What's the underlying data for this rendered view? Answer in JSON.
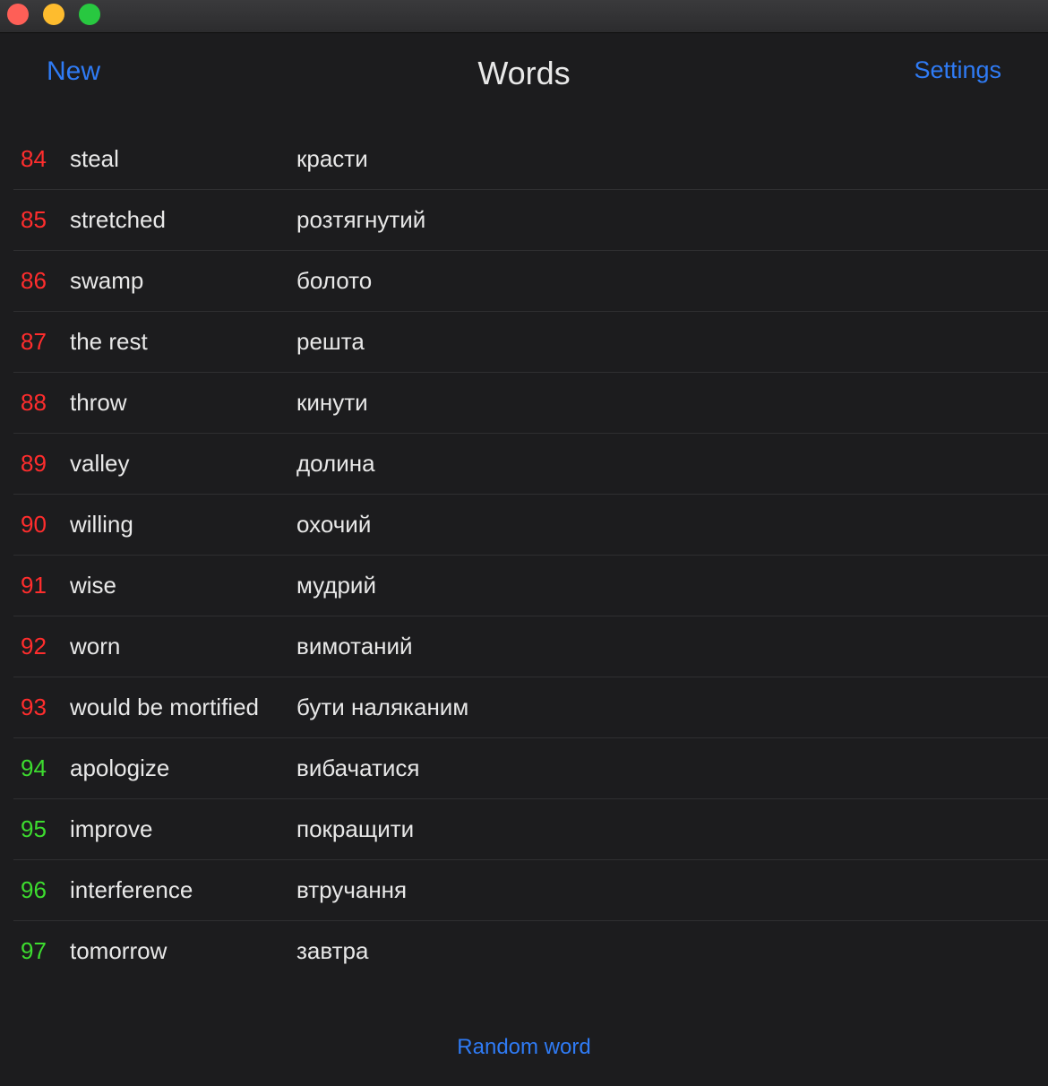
{
  "window": {
    "controls": [
      "close",
      "minimize",
      "maximize"
    ],
    "colors": {
      "close": "#fe5f57",
      "minimize": "#febc2e",
      "maximize": "#28c840"
    }
  },
  "nav": {
    "left_button": "New",
    "title": "Words",
    "right_button": "Settings"
  },
  "words": [
    {
      "num": "84",
      "word": "steal",
      "translation": "красти",
      "status": "red"
    },
    {
      "num": "85",
      "word": "stretched",
      "translation": "розтягнутий",
      "status": "red"
    },
    {
      "num": "86",
      "word": "swamp",
      "translation": "болото",
      "status": "red"
    },
    {
      "num": "87",
      "word": "the rest",
      "translation": "решта",
      "status": "red"
    },
    {
      "num": "88",
      "word": "throw",
      "translation": "кинути",
      "status": "red"
    },
    {
      "num": "89",
      "word": "valley",
      "translation": "долина",
      "status": "red"
    },
    {
      "num": "90",
      "word": "willing",
      "translation": "охочий",
      "status": "red"
    },
    {
      "num": "91",
      "word": "wise",
      "translation": "мудрий",
      "status": "red"
    },
    {
      "num": "92",
      "word": "worn",
      "translation": "вимотаний",
      "status": "red"
    },
    {
      "num": "93",
      "word": "would be mortified",
      "translation": "бути наляканим",
      "status": "red"
    },
    {
      "num": "94",
      "word": "apologize",
      "translation": "вибачатися",
      "status": "green"
    },
    {
      "num": "95",
      "word": "improve",
      "translation": "покращити",
      "status": "green"
    },
    {
      "num": "96",
      "word": "interference",
      "translation": "втручання",
      "status": "green"
    },
    {
      "num": "97",
      "word": "tomorrow",
      "translation": "завтра",
      "status": "green"
    }
  ],
  "footer": {
    "random_button": "Random word"
  },
  "colors": {
    "accent": "#2f7bf5",
    "red_number": "#ff2d2d",
    "green_number": "#3ddc2f",
    "background": "#1c1c1e"
  }
}
